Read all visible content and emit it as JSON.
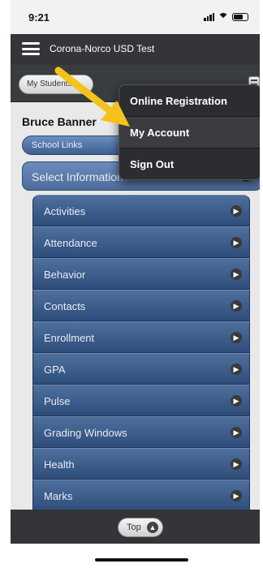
{
  "status_bar": {
    "time": "9:21"
  },
  "header": {
    "title": "Corona-Norco USD Test"
  },
  "toolbar": {
    "students_button": "My Students"
  },
  "student": {
    "name": "Bruce Banner"
  },
  "school_links": "School Links",
  "select_information": "Select Information",
  "menu_items": [
    "Activities",
    "Attendance",
    "Behavior",
    "Contacts",
    "Enrollment",
    "GPA",
    "Pulse",
    "Grading Windows",
    "Health",
    "Marks"
  ],
  "popup_menu": {
    "items": [
      "Online Registration",
      "My Account",
      "Sign Out"
    ]
  },
  "footer": {
    "top_button": "Top"
  },
  "annotation": {
    "arrow_color": "#F5C21B"
  },
  "icons": {
    "hamburger": "hamburger-icon",
    "options": "options-icon",
    "chevron_right": "chevron-right-icon",
    "chevron_up": "chevron-up-icon"
  }
}
